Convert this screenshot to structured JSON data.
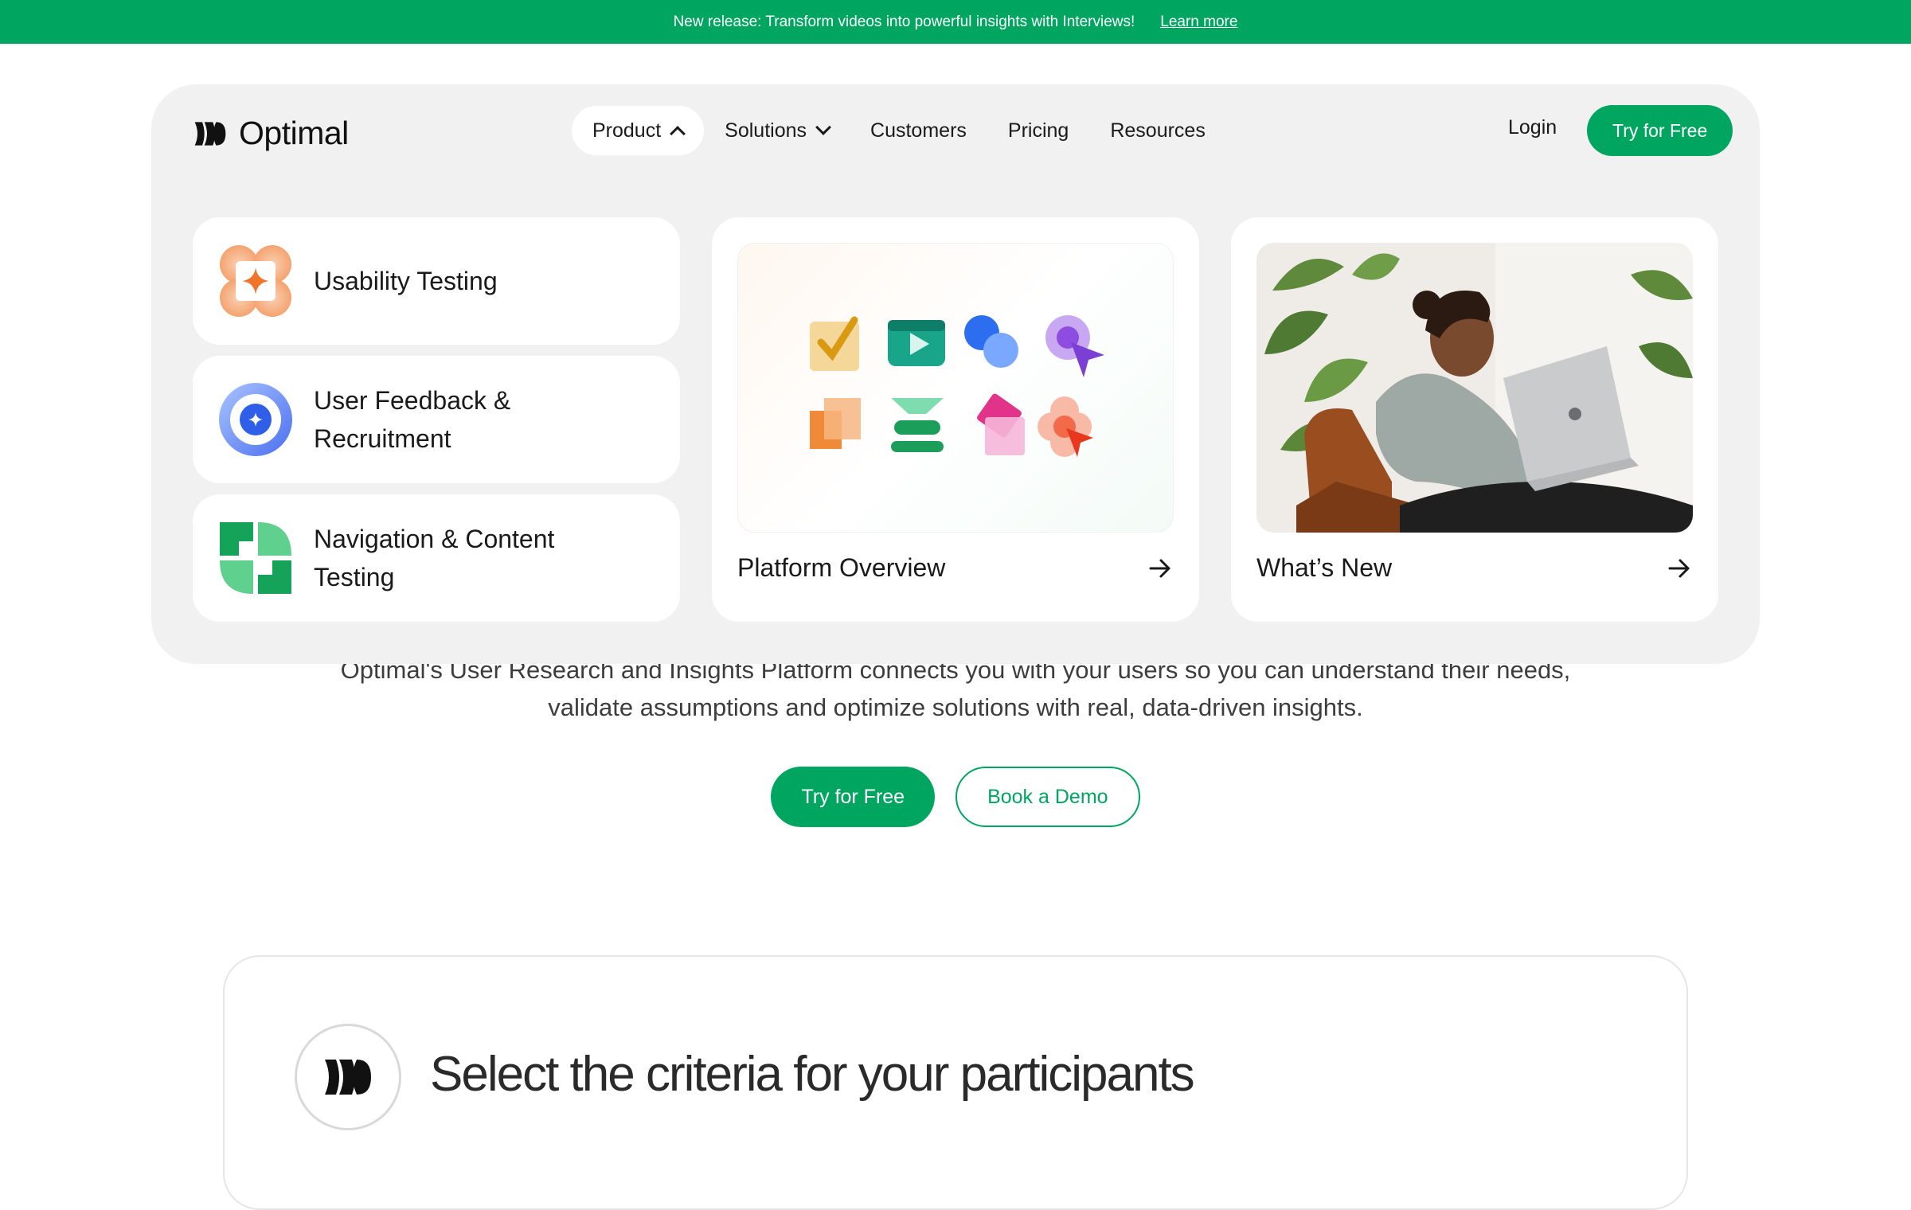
{
  "banner": {
    "text": "New release: Transform videos into powerful insights with Interviews!",
    "link": "Learn more"
  },
  "brand": {
    "name": "Optimal"
  },
  "nav": {
    "items": [
      {
        "label": "Product"
      },
      {
        "label": "Solutions"
      },
      {
        "label": "Customers"
      },
      {
        "label": "Pricing"
      },
      {
        "label": "Resources"
      }
    ],
    "login": "Login",
    "cta": "Try for Free"
  },
  "menu": {
    "products": [
      {
        "label": "Usability Testing",
        "icon": "usability-testing-icon"
      },
      {
        "label_line1": "User Feedback &",
        "label_line2": "Recruitment",
        "icon": "user-feedback-icon"
      },
      {
        "label_line1": "Navigation & Content",
        "label_line2": "Testing",
        "icon": "navigation-content-icon"
      }
    ],
    "platform": {
      "label": "Platform Overview",
      "icon": "arrow-right-icon"
    },
    "whats_new": {
      "label": "What’s New",
      "icon": "arrow-right-icon"
    }
  },
  "hero": {
    "line1": "Optimal's User Research and Insights Platform connects you with your users so you can understand their needs,",
    "line2": "validate assumptions and optimize solutions with real, data-driven insights.",
    "primary_cta": "Try for Free",
    "secondary_cta": "Book a Demo"
  },
  "criteria": {
    "title": "Select the criteria for your participants"
  },
  "colors": {
    "brand_green": "#00a660",
    "panel_bg": "#f1f1f1"
  }
}
